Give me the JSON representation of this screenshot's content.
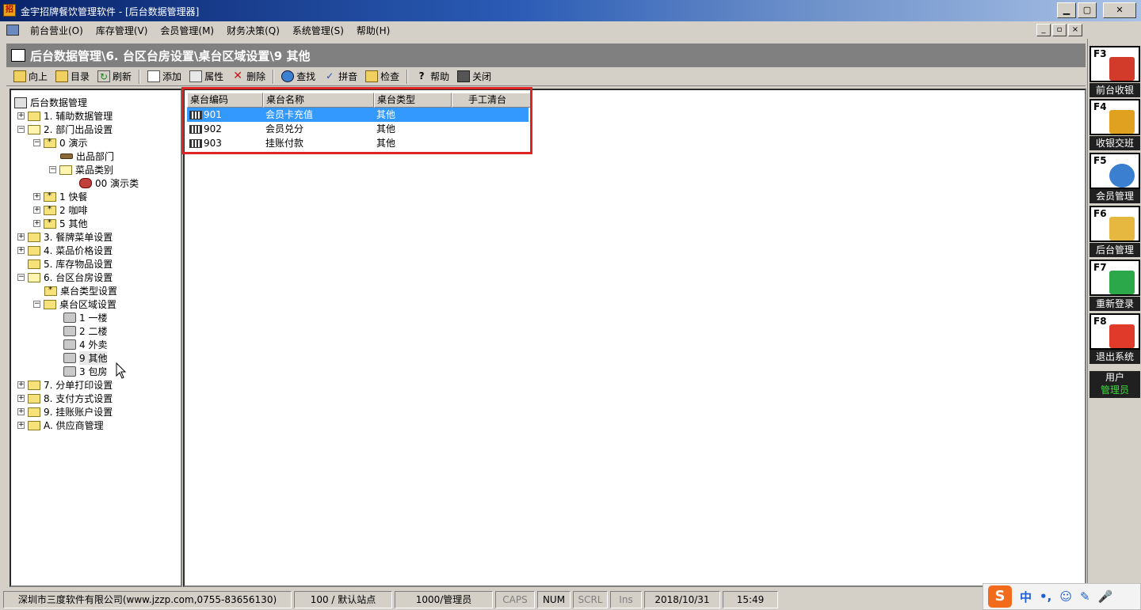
{
  "window": {
    "title": "金宇招牌餐饮管理软件 - [后台数据管理器]",
    "minimize": "▁",
    "maximize": "▢",
    "close": "✕"
  },
  "menu": [
    "前台营业(O)",
    "库存管理(V)",
    "会员管理(M)",
    "财务决策(Q)",
    "系统管理(S)",
    "帮助(H)"
  ],
  "mdi_buttons": [
    "_",
    "▫",
    "×"
  ],
  "breadcrumb": "后台数据管理\\6. 台区台房设置\\桌台区域设置\\9 其他",
  "toolbar": {
    "up": "向上",
    "catalog": "目录",
    "refresh": "刷新",
    "add": "添加",
    "properties": "属性",
    "delete": "删除",
    "find": "查找",
    "pinyin": "拼音",
    "check": "检查",
    "help": "帮助",
    "close": "关闭"
  },
  "tree": {
    "root": "后台数据管理",
    "n1": "1. 辅助数据管理",
    "n2": "2. 部门出品设置",
    "n2_0": "0 演示",
    "n2_0_a": "出品部门",
    "n2_0_b": "菜品类别",
    "n2_0_b_0": "00 演示类",
    "n2_1": "1 快餐",
    "n2_2": "2 咖啡",
    "n2_5": "5 其他",
    "n3": "3. 餐牌菜单设置",
    "n4": "4. 菜品价格设置",
    "n5": "5. 库存物品设置",
    "n6": "6. 台区台房设置",
    "n6_a": "桌台类型设置",
    "n6_b": "桌台区域设置",
    "n6_b_1": "1 一楼",
    "n6_b_2": "2 二楼",
    "n6_b_4": "4 外卖",
    "n6_b_9": "9 其他",
    "n6_b_3": "3 包房",
    "n7": "7. 分单打印设置",
    "n8": "8. 支付方式设置",
    "n9": "9. 挂账账户设置",
    "nA": "A. 供应商管理"
  },
  "table": {
    "columns": [
      "桌台编码",
      "桌台名称",
      "桌台类型",
      "手工清台"
    ],
    "rows": [
      {
        "code": "901",
        "name": "会员卡充值",
        "type": "其他",
        "manual": ""
      },
      {
        "code": "902",
        "name": "会员兑分",
        "type": "其他",
        "manual": ""
      },
      {
        "code": "903",
        "name": "挂账付款",
        "type": "其他",
        "manual": ""
      }
    ]
  },
  "side_panel": [
    {
      "key": "F3",
      "label": "前台收银",
      "icon": "cashier-table-icon",
      "color": "#d23b2a"
    },
    {
      "key": "F4",
      "label": "收银交班",
      "icon": "clipboard-check-icon",
      "color": "#e0a020"
    },
    {
      "key": "F5",
      "label": "会员管理",
      "icon": "members-icon",
      "color": "#3a7fd0"
    },
    {
      "key": "F6",
      "label": "后台管理",
      "icon": "folder-tools-icon",
      "color": "#e6b840"
    },
    {
      "key": "F7",
      "label": "重新登录",
      "icon": "hourglass-icon",
      "color": "#2aa84a"
    },
    {
      "key": "F8",
      "label": "退出系统",
      "icon": "power-icon",
      "color": "#e03a2a"
    }
  ],
  "user": {
    "label": "用户",
    "name": "管理员"
  },
  "status": {
    "company": "深圳市三度软件有限公司(www.jzzp.com,0755-83656130)",
    "station": "100 / 默认站点",
    "operator": "1000/管理员",
    "caps": "CAPS",
    "num": "NUM",
    "scrl": "SCRL",
    "ins": "Ins",
    "date": "2018/10/31",
    "time": "15:49"
  },
  "ime": {
    "logo": "S",
    "lang": "中",
    "punct": "•,",
    "emoji": "☺",
    "pen": "✎",
    "mic": "🎤"
  }
}
